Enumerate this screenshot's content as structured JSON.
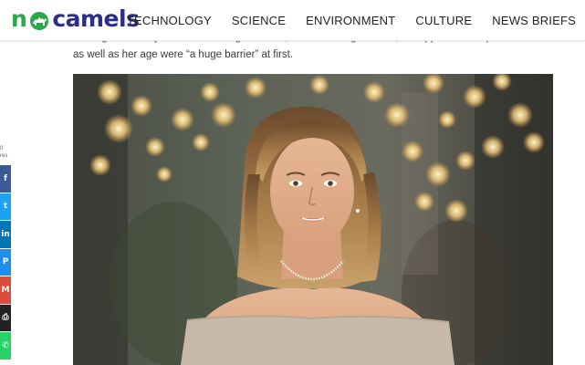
{
  "header": {
    "logo_text_n": "n",
    "logo_text_rest": "camels",
    "nav": [
      "TECHNOLOGY",
      "SCIENCE",
      "ENVIRONMENT",
      "CULTURE",
      "NEWS BRIEFS"
    ]
  },
  "article": {
    "paragraph": "Finding the money was not so straightforward, and according to Biton, her appearance – petite blonde – as well as her age were “a huge barrier” at first."
  },
  "share": {
    "count_text": "0\nres",
    "buttons": [
      {
        "name": "facebook-share-button",
        "icon": "facebook-icon",
        "glyph": "f",
        "color": "#3b5998"
      },
      {
        "name": "twitter-share-button",
        "icon": "twitter-icon",
        "glyph": "t",
        "color": "#1da1f2"
      },
      {
        "name": "linkedin-share-button",
        "icon": "linkedin-icon",
        "glyph": "in",
        "color": "#0077b5"
      },
      {
        "name": "pinterest-share-button",
        "icon": "pinterest-icon",
        "glyph": "P",
        "color": "#1c8ff0"
      },
      {
        "name": "email-share-button",
        "icon": "email-icon",
        "glyph": "M",
        "color": "#e04a3c"
      },
      {
        "name": "print-share-button",
        "icon": "print-icon",
        "glyph": "⎙",
        "color": "#222222"
      },
      {
        "name": "whatsapp-share-button",
        "icon": "whatsapp-icon",
        "glyph": "✆",
        "color": "#25d366"
      }
    ]
  },
  "colors": {
    "brand_green": "#2aa84a",
    "brand_navy": "#2d2d8a"
  }
}
